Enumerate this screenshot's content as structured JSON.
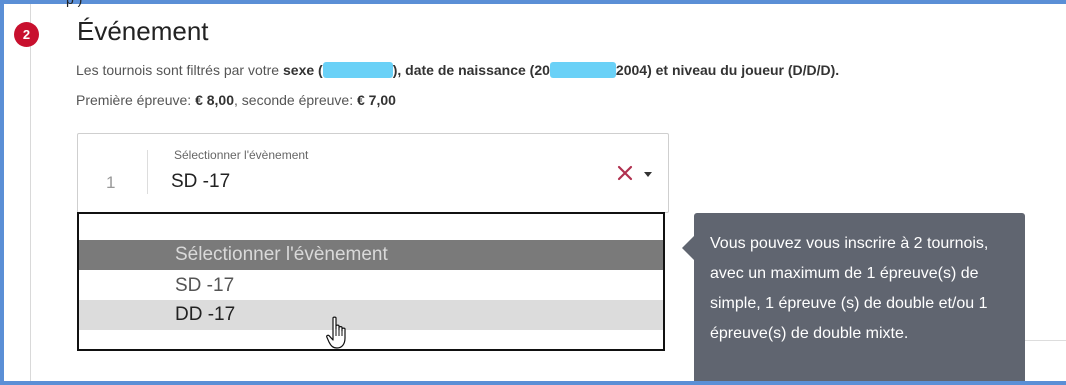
{
  "header": {
    "step_number": "2",
    "title": "Événement",
    "clipped_text": "p )"
  },
  "info": {
    "line1_prefix": "Les tournois sont filtrés par votre ",
    "sexe_label": "sexe",
    "sexe_open": " (",
    "sexe_close": "),",
    "dob_label": " date de naissance",
    "dob_open": " (20",
    "dob_close": "2004) et ",
    "level_label": "niveau du joueur (D/D/D).",
    "line2_first_label": "Première épreuve: ",
    "line2_first_price": "€ 8,00",
    "line2_sep": ", seconde épreuve: ",
    "line2_second_price": "€ 7,00"
  },
  "select": {
    "slot_number": "1",
    "label": "Sélectionner l'évènement",
    "value": "SD -17",
    "clear_icon": "close-icon",
    "caret_icon": "chevron-down-icon"
  },
  "dropdown": {
    "options": [
      "Sélectionner l'évènement",
      "SD -17",
      "DD -17"
    ],
    "highlighted_index": 2
  },
  "tooltip": {
    "text": "Vous pouvez vous inscrire à 2 tournois, avec un maximum de 1 épreuve(s) de simple, 1 épreuve (s) de double et/ou 1 épreuve(s) de double mixte."
  },
  "colors": {
    "badge": "#c8102e",
    "tooltip_bg": "#606570",
    "redaction": "#6ad1f7",
    "frame": "#5b8fd6"
  }
}
